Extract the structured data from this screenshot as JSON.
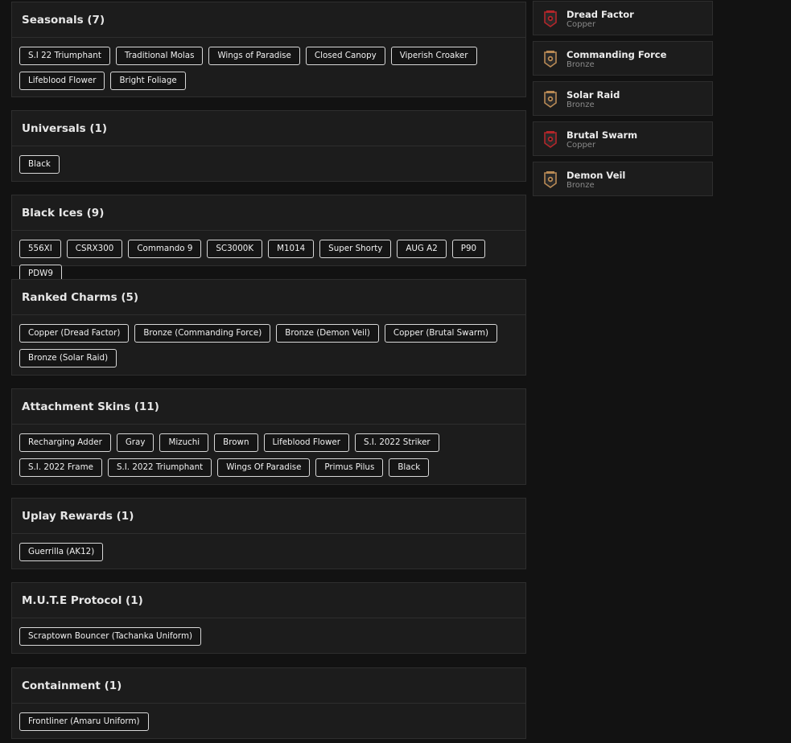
{
  "sections": [
    {
      "title": "Seasonals (7)",
      "items": [
        "S.I 22 Triumphant",
        "Traditional Molas",
        "Wings of Paradise",
        "Closed Canopy",
        "Viperish Croaker",
        "Lifeblood Flower",
        "Bright Foliage"
      ]
    },
    {
      "title": "Universals (1)",
      "items": [
        "Black"
      ]
    },
    {
      "title": "Black Ices (9)",
      "items": [
        "556XI",
        "CSRX300",
        "Commando 9",
        "SC3000K",
        "M1014",
        "Super Shorty",
        "AUG A2",
        "P90",
        "PDW9"
      ]
    },
    {
      "title": "Ranked Charms (5)",
      "items": [
        "Copper (Dread Factor)",
        "Bronze (Commanding Force)",
        "Bronze (Demon Veil)",
        "Copper (Brutal Swarm)",
        "Bronze (Solar Raid)"
      ]
    },
    {
      "title": "Attachment Skins (11)",
      "items": [
        "Recharging Adder",
        "Gray",
        "Mizuchi",
        "Brown",
        "Lifeblood Flower",
        "S.I. 2022 Striker",
        "S.I. 2022 Frame",
        "S.I. 2022 Triumphant",
        "Wings Of Paradise",
        "Primus Pilus",
        "Black"
      ]
    },
    {
      "title": "Uplay Rewards (1)",
      "items": [
        "Guerrilla (AK12)"
      ]
    },
    {
      "title": "M.U.T.E Protocol (1)",
      "items": [
        "Scraptown Bouncer (Tachanka Uniform)"
      ]
    },
    {
      "title": "Containment (1)",
      "items": [
        "Frontliner (Amaru Uniform)"
      ]
    }
  ],
  "charms": [
    {
      "name": "Dread Factor",
      "tier": "Copper",
      "icon": "copper-rank-icon",
      "color": "#b3262a"
    },
    {
      "name": "Commanding Force",
      "tier": "Bronze",
      "icon": "bronze-rank-icon",
      "color": "#b98a55"
    },
    {
      "name": "Solar Raid",
      "tier": "Bronze",
      "icon": "bronze-rank-icon",
      "color": "#b98a55"
    },
    {
      "name": "Brutal Swarm",
      "tier": "Copper",
      "icon": "copper-rank-icon",
      "color": "#b3262a"
    },
    {
      "name": "Demon Veil",
      "tier": "Bronze",
      "icon": "bronze-rank-icon",
      "color": "#b98a55"
    }
  ]
}
